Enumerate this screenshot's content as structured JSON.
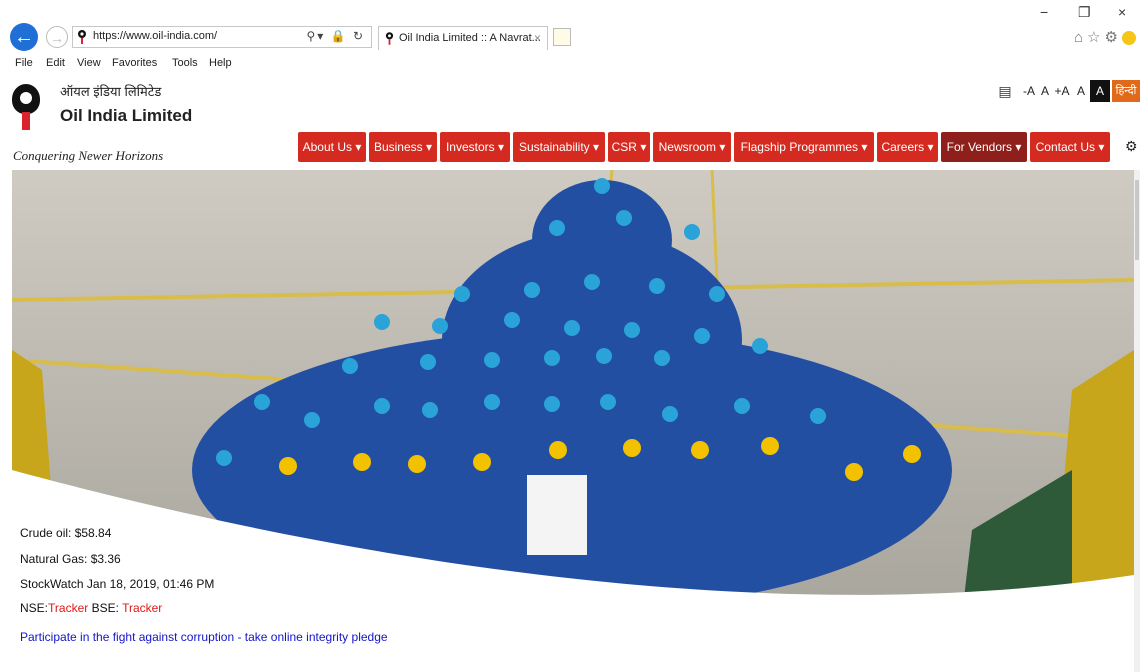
{
  "browser": {
    "url_scheme": "https://",
    "url_host": "www.oil-india.com/",
    "tab_title": "Oil India Limited :: A Navrat...",
    "tab_close": "×",
    "menu": [
      "File",
      "Edit",
      "View",
      "Favorites",
      "Tools",
      "Help"
    ],
    "window_controls": [
      "−",
      "❐",
      "×"
    ]
  },
  "header": {
    "logo_hindi": "ऑयल इंडिया लिमिटेड",
    "logo_english": "Oil India Limited",
    "tagline": "Conquering Newer Horizons",
    "accessibility": [
      "-A",
      "A",
      "+A",
      "A",
      "A",
      "हिन्दी"
    ]
  },
  "nav": {
    "items": [
      {
        "label": "About Us"
      },
      {
        "label": "Business"
      },
      {
        "label": "Investors"
      },
      {
        "label": "Sustainability"
      },
      {
        "label": "CSR"
      },
      {
        "label": "Newsroom"
      },
      {
        "label": "Flagship Programmes"
      },
      {
        "label": "Careers"
      },
      {
        "label": "For Vendors"
      },
      {
        "label": "Contact Us"
      }
    ],
    "dropdown_caret": "▾"
  },
  "ticker": {
    "crude": "Crude oil: $58.84",
    "gas": "Natural Gas: $3.36",
    "stockwatch": "StockWatch Jan 18, 2019, 01:46 PM",
    "nse_label": "NSE:",
    "nse_value": "Tracker",
    "bse_label": "BSE:",
    "bse_value": "Tracker"
  },
  "integrity_link": "Participate in the fight against corruption - take online integrity pledge",
  "colors": {
    "nav_red": "#d42a20",
    "nav_dark": "#8e1f1a",
    "browser_blue": "#1f6fd6",
    "link_blue": "#1515c8",
    "ticker_red": "#e01818"
  }
}
